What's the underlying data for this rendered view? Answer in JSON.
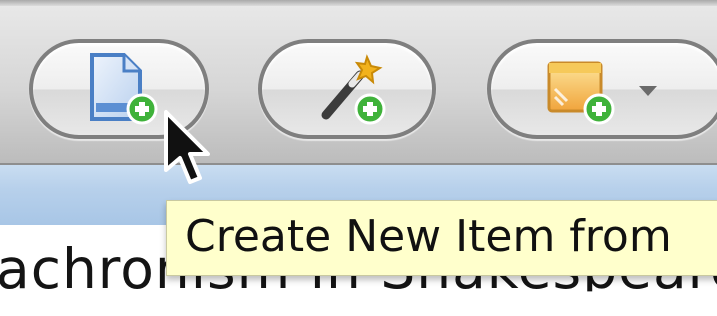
{
  "toolbar": {
    "buttons": [
      {
        "name": "new-item-button",
        "icon": "new-document-icon",
        "badge": "plus-badge-icon"
      },
      {
        "name": "wand-button",
        "icon": "magic-wand-icon",
        "badge": "plus-badge-icon"
      },
      {
        "name": "media-button",
        "icon": "media-folder-icon",
        "badge": "plus-badge-icon",
        "has_dropdown": true
      }
    ]
  },
  "tooltip": {
    "text": "Create New Item from"
  },
  "content": {
    "visible_text": "achronism in Shakespeare C"
  },
  "colors": {
    "tooltip_bg": "#ffffcc",
    "band_blue": "#b7d0eb",
    "badge_green": "#3fb23a",
    "doc_blue": "#5c8fd3"
  }
}
